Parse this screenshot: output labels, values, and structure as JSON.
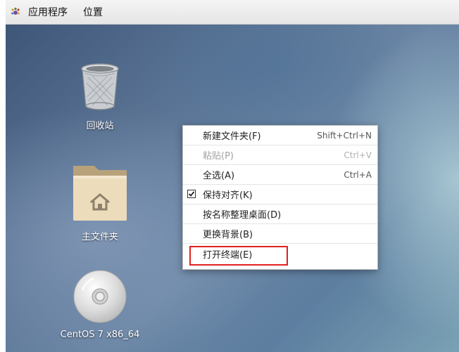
{
  "topbar": {
    "applications": "应用程序",
    "places": "位置"
  },
  "desktop": {
    "icons": [
      {
        "label": "回收站",
        "icon": "trash-icon"
      },
      {
        "label": "主文件夹",
        "icon": "home-folder-icon"
      },
      {
        "label": "CentOS 7 x86_64",
        "icon": "disc-icon"
      }
    ]
  },
  "context_menu": {
    "items": [
      {
        "label": "新建文件夹(F)",
        "shortcut": "Shift+Ctrl+N",
        "enabled": true
      },
      {
        "label": "粘贴(P)",
        "shortcut": "Ctrl+V",
        "enabled": false
      },
      {
        "label": "全选(A)",
        "shortcut": "Ctrl+A",
        "enabled": true
      },
      {
        "label": "保持对齐(K)",
        "checked": true,
        "enabled": true
      },
      {
        "label": "按名称整理桌面(D)",
        "enabled": true
      },
      {
        "label": "更换背景(B)",
        "enabled": true
      },
      {
        "label": "打开终端(E)",
        "enabled": true,
        "highlighted": true
      }
    ]
  },
  "colors": {
    "highlight_box": "#e02020",
    "menu_disabled": "#a2a2a2"
  }
}
